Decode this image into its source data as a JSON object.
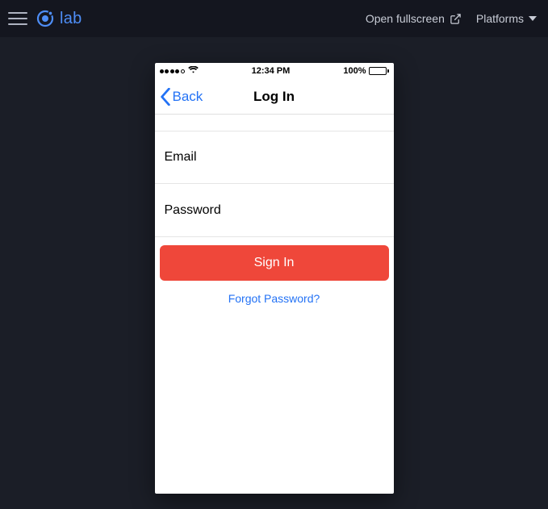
{
  "topbar": {
    "logo_text": "lab",
    "fullscreen_label": "Open fullscreen",
    "platforms_label": "Platforms"
  },
  "device": {
    "statusbar": {
      "time": "12:34 PM",
      "battery_pct": "100%"
    },
    "nav": {
      "back_label": "Back",
      "title": "Log In"
    },
    "form": {
      "email_placeholder": "Email",
      "password_placeholder": "Password",
      "signin_label": "Sign In",
      "forgot_label": "Forgot Password?"
    }
  }
}
